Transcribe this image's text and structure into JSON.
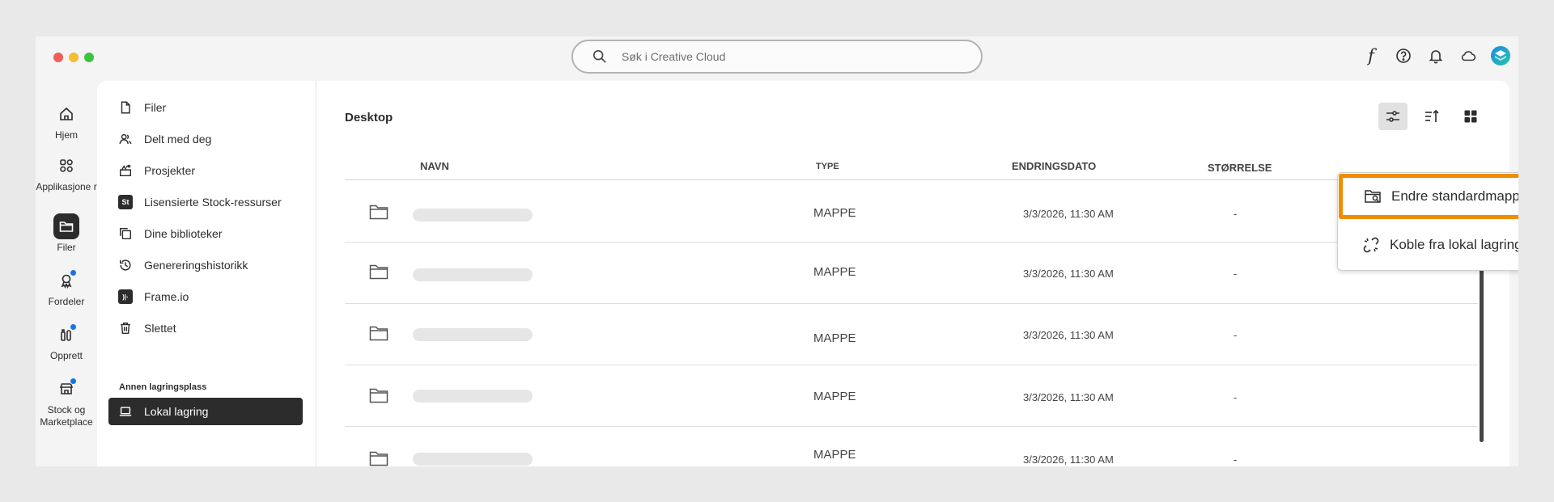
{
  "search": {
    "placeholder": "Søk i Creative Cloud"
  },
  "topbar": {
    "fonts_glyph": "f"
  },
  "rail": {
    "items": [
      {
        "label": "Hjem",
        "icon": "home-icon"
      },
      {
        "label": "Applikasjone r",
        "icon": "apps-icon"
      },
      {
        "label": "Filer",
        "icon": "folder-icon",
        "active": true
      },
      {
        "label": "Fordeler",
        "icon": "benefits-icon"
      },
      {
        "label": "Opprett",
        "icon": "create-icon"
      },
      {
        "label": "Stock og Marketplace",
        "icon": "marketplace-icon"
      }
    ]
  },
  "nav": {
    "items": [
      {
        "label": "Filer",
        "icon": "file-icon"
      },
      {
        "label": "Delt med deg",
        "icon": "shared-icon"
      },
      {
        "label": "Prosjekter",
        "icon": "projects-icon"
      },
      {
        "label": "Lisensierte Stock-ressurser",
        "icon": "stock-icon",
        "badge": "St"
      },
      {
        "label": "Dine biblioteker",
        "icon": "libraries-icon"
      },
      {
        "label": "Genereringshistorikk",
        "icon": "history-icon"
      },
      {
        "label": "Frame.io",
        "icon": "frameio-icon"
      },
      {
        "label": "Slettet",
        "icon": "trash-icon"
      }
    ],
    "section_label": "Annen lagringsplass",
    "local": {
      "label": "Lokal lagring",
      "icon": "laptop-icon",
      "active": true
    }
  },
  "main": {
    "title": "Desktop",
    "columns": {
      "name": "NAVN",
      "type": "TYPE",
      "modified": "ENDRINGSDATO",
      "size": "STØRRELSE"
    },
    "rows": [
      {
        "type": "MAPPE",
        "date": "3/3/2026, 11:30 AM",
        "size": "-"
      },
      {
        "type": "MAPPE",
        "date": "3/3/2026, 11:30 AM",
        "size": "-"
      },
      {
        "type": "MAPPE",
        "date": "3/3/2026, 11:30 AM",
        "size": "-"
      },
      {
        "type": "MAPPE",
        "date": "3/3/2026, 11:30 AM",
        "size": "-"
      },
      {
        "type": "MAPPE",
        "date": "3/3/2026, 11:30 AM",
        "size": "-"
      }
    ]
  },
  "dropdown": {
    "items": [
      {
        "label": "Endre standardmappe",
        "icon": "folder-search-icon",
        "highlighted": true
      },
      {
        "label": "Koble fra lokal lagring",
        "icon": "unlink-icon"
      }
    ]
  },
  "colors": {
    "highlight": "#f08c00",
    "active_bg": "#2c2c2c",
    "badge_blue": "#1473e6"
  }
}
